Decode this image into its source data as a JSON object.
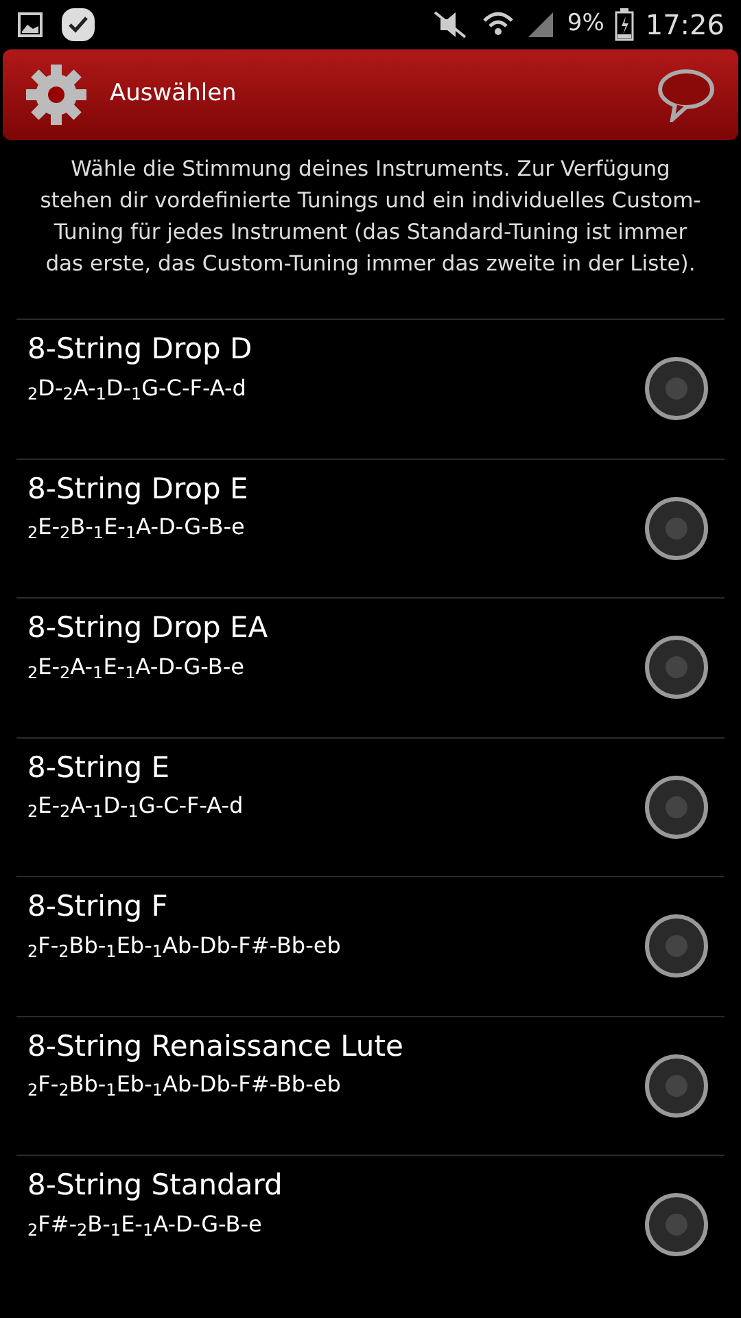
{
  "status_bar": {
    "battery": "9%",
    "time": "17:26"
  },
  "header": {
    "title": "Auswählen"
  },
  "description": "Wähle die Stimmung deines Instruments. Zur Verfügung stehen dir vordefinierte Tunings und ein individuelles Custom-Tuning für jedes Instrument (das Standard-Tuning ist immer das erste, das Custom-Tuning immer das zweite in der Liste).",
  "tunings": [
    {
      "name": "8-String Drop D",
      "notes": "$_{2}$D-$_{2}$A-$_{1}$D-$_{1}$G-C-F-A-d",
      "selected": false
    },
    {
      "name": "8-String Drop E",
      "notes": "$_{2}$E-$_{2}$B-$_{1}$E-$_{1}$A-D-G-B-e",
      "selected": false
    },
    {
      "name": "8-String Drop EA",
      "notes": "$_{2}$E-$_{2}$A-$_{1}$E-$_{1}$A-D-G-B-e",
      "selected": false
    },
    {
      "name": "8-String E",
      "notes": "$_{2}$E-$_{2}$A-$_{1}$D-$_{1}$G-C-F-A-d",
      "selected": false
    },
    {
      "name": "8-String F",
      "notes": "$_{2}$F-$_{2}$Bb-$_{1}$Eb-$_{1}$Ab-Db-F#-Bb-eb",
      "selected": false
    },
    {
      "name": "8-String Renaissance Lute",
      "notes": "$_{2}$F-$_{2}$Bb-$_{1}$Eb-$_{1}$Ab-Db-F#-Bb-eb",
      "selected": false
    },
    {
      "name": "8-String Standard",
      "notes": "$_{2}$F#-$_{2}$B-$_{1}$E-$_{1}$A-D-G-B-e",
      "selected": false
    }
  ]
}
